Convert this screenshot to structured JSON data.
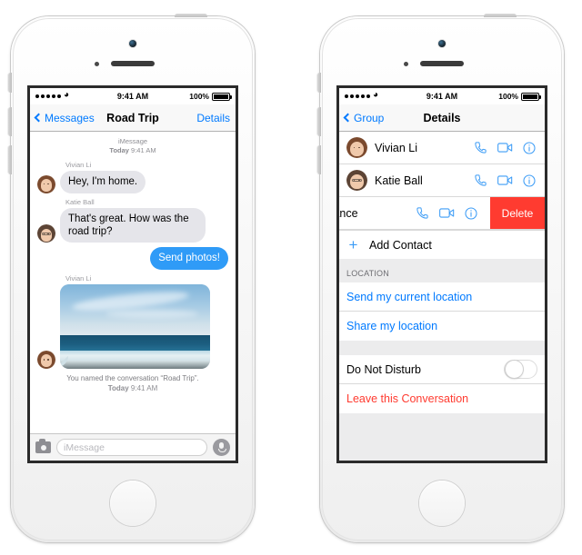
{
  "status_bar": {
    "signal_dots": 5,
    "wifi_icon": "wifi-icon",
    "time": "9:41 AM",
    "battery_percent": "100%"
  },
  "left_phone": {
    "nav": {
      "back_label": "Messages",
      "title": "Road Trip",
      "right_label": "Details"
    },
    "thread": {
      "service_label": "iMessage",
      "timestamp_day": "Today",
      "timestamp_time": "9:41 AM",
      "messages": [
        {
          "sender": "Vivian Li",
          "text": "Hey, I'm home.",
          "direction": "in",
          "type": "text"
        },
        {
          "sender": "Katie Ball",
          "text": "That's great. How was the road trip?",
          "direction": "in",
          "type": "text"
        },
        {
          "sender": "",
          "text": "Send photos!",
          "direction": "out",
          "type": "text"
        },
        {
          "sender": "Vivian Li",
          "text": "",
          "direction": "in",
          "type": "photo",
          "photo_alt": "beach-photo"
        }
      ],
      "system_note_line1": "You named the conversation “Road Trip”.",
      "system_note_day": "Today",
      "system_note_time": "9:41 AM"
    },
    "compose": {
      "camera_icon": "camera-icon",
      "placeholder": "iMessage",
      "value": "",
      "mic_icon": "microphone-icon"
    }
  },
  "right_phone": {
    "nav": {
      "back_label": "Group",
      "title": "Details",
      "right_label": ""
    },
    "contacts": [
      {
        "name": "Vivian Li",
        "swiped": false,
        "delete_label": ""
      },
      {
        "name": "Katie Ball",
        "swiped": false,
        "delete_label": ""
      },
      {
        "name": "Vance",
        "swiped": true,
        "delete_label": "Delete"
      }
    ],
    "row_icons": {
      "call": "phone-icon",
      "video": "video-camera-icon",
      "info": "info-icon"
    },
    "add_contact": {
      "icon": "plus-icon",
      "label": "Add Contact"
    },
    "location_section": {
      "header": "LOCATION",
      "items": [
        "Send my current location",
        "Share my location"
      ]
    },
    "do_not_disturb": {
      "label": "Do Not Disturb",
      "enabled": false
    },
    "leave_conversation": {
      "label": "Leave this Conversation"
    }
  },
  "colors": {
    "ios_blue": "#007aff",
    "bubble_blue": "#2f9bf7",
    "bubble_gray": "#e5e5ea",
    "destructive_red": "#ff3b30",
    "group_bg": "#ececed"
  }
}
